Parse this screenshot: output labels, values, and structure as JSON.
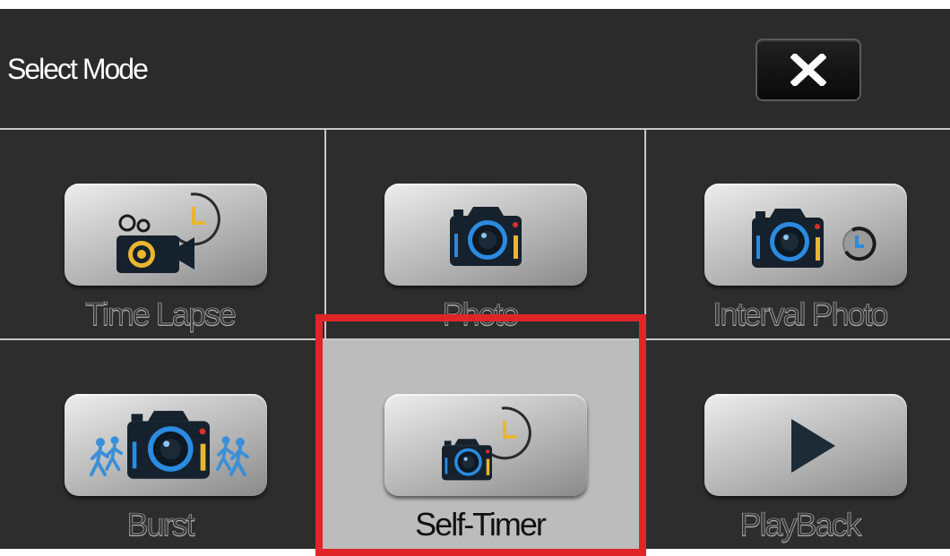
{
  "header": {
    "title": "Select Mode",
    "close_icon": "close-x-icon"
  },
  "modes": [
    {
      "label": "Time Lapse",
      "icon": "time-lapse-camera-icon",
      "selected": false
    },
    {
      "label": "Photo",
      "icon": "photo-camera-icon",
      "selected": false
    },
    {
      "label": "Interval Photo",
      "icon": "interval-photo-icon",
      "selected": false
    },
    {
      "label": "Burst",
      "icon": "burst-camera-icon",
      "selected": false
    },
    {
      "label": "Self-Timer",
      "icon": "self-timer-camera-icon",
      "selected": true
    },
    {
      "label": "PlayBack",
      "icon": "play-icon",
      "selected": false
    }
  ],
  "colors": {
    "background": "#2d2d2d",
    "selected_cell": "#bcbcbc",
    "highlight_border": "#e0252a",
    "camera_blue": "#2f8fe0",
    "accent_yellow": "#e8b630"
  }
}
